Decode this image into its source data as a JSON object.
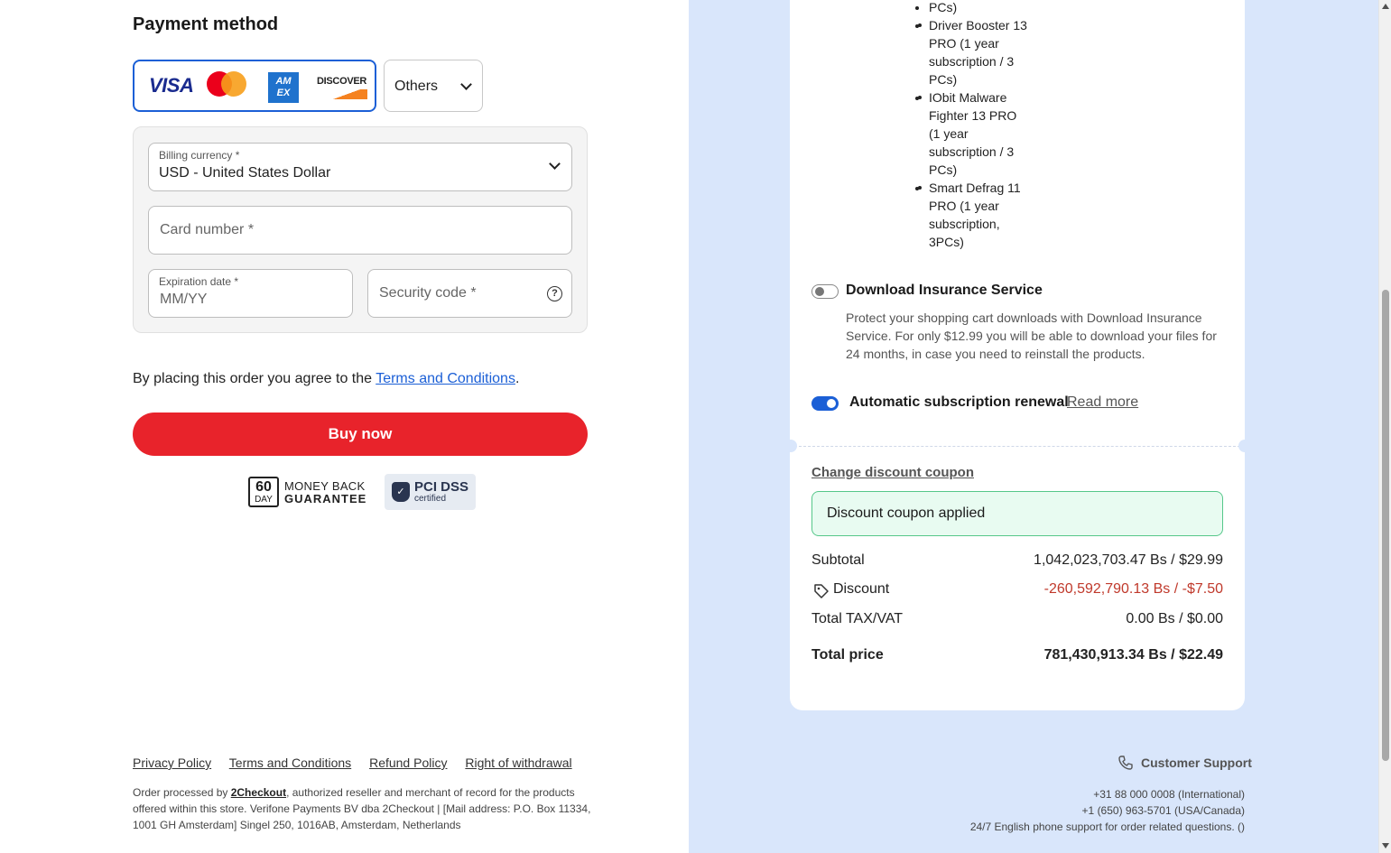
{
  "payment": {
    "title": "Payment method",
    "card_brands": [
      "VISA",
      "mastercard",
      "AM EX",
      "DISCOVER"
    ],
    "others_label": "Others",
    "billing_currency_label": "Billing currency *",
    "billing_currency_value": "USD - United States Dollar",
    "card_number_placeholder": "Card number *",
    "expiration_label": "Expiration date *",
    "expiration_placeholder": "MM/YY",
    "security_code_placeholder": "Security code *",
    "help_glyph": "?"
  },
  "agreement": {
    "prefix": "By placing this order you agree to the ",
    "link": "Terms and Conditions",
    "suffix": "."
  },
  "buy_button": "Buy now",
  "badges": {
    "money_back_number": "60",
    "money_back_unit": "DAY",
    "money_back_line1": "MONEY BACK",
    "money_back_line2": "GUARANTEE",
    "pci_title": "PCI DSS",
    "pci_subtitle": "certified"
  },
  "footer": {
    "links": [
      "Privacy Policy",
      "Terms and Conditions",
      "Refund Policy",
      "Right of withdrawal"
    ],
    "legal_prefix": "Order processed by ",
    "legal_link": "2Checkout",
    "legal_suffix": ", authorized reseller and merchant of record for the products offered within this store. Verifone Payments BV dba 2Checkout | [Mail address: P.O. Box 11334, 1001 GH Amsterdam] Singel 250, 1016AB, Amsterdam, Netherlands"
  },
  "cart": {
    "bullet_fragment": "PCs)",
    "bullets": [
      "Driver Booster 13 PRO (1 year subscription / 3 PCs)",
      "IObit Malware Fighter 13 PRO (1 year subscription / 3 PCs)",
      "Smart Defrag 11 PRO (1 year subscription, 3PCs)"
    ],
    "download_insurance": {
      "title": "Download Insurance Service",
      "enabled": false,
      "description": "Protect your shopping cart downloads with Download Insurance Service. For only $12.99 you will be able to download your files for 24 months, in case you need to reinstall the products."
    },
    "auto_renewal": {
      "title": "Automatic subscription renewal",
      "enabled": true,
      "read_more": "Read more"
    },
    "change_coupon": "Change discount coupon",
    "coupon_status": "Discount coupon applied",
    "subtotal_label": "Subtotal",
    "subtotal_value": "1,042,023,703.47 Bs / $29.99",
    "discount_label": "Discount",
    "discount_value": "-260,592,790.13 Bs / -$7.50",
    "tax_label": "Total TAX/VAT",
    "tax_value": "0.00 Bs / $0.00",
    "total_label": "Total price",
    "total_value": "781,430,913.34 Bs / $22.49"
  },
  "support": {
    "title": "Customer Support",
    "lines": [
      "+31 88 000 0008 (International)",
      "+1 (650) 963-5701 (USA/Canada)",
      "24/7 English phone support for order related questions. ()"
    ]
  },
  "colors": {
    "accent_blue": "#1b5fd6",
    "buy_red": "#e8232b",
    "right_panel_bg": "#d9e6fb",
    "discount_red": "#c0392b",
    "coupon_green_border": "#56c78a"
  }
}
